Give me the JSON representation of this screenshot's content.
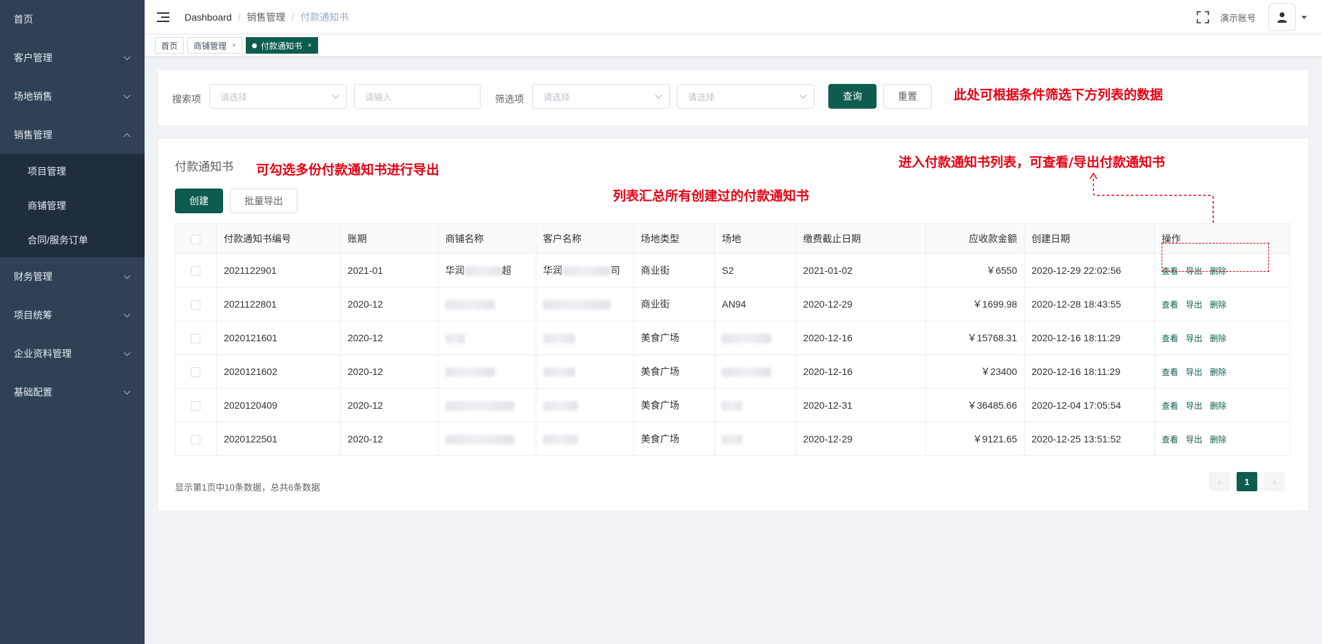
{
  "sidebar": {
    "items": [
      {
        "label": "首页"
      },
      {
        "label": "客户管理"
      },
      {
        "label": "场地销售"
      },
      {
        "label": "销售管理"
      },
      {
        "label": "财务管理"
      },
      {
        "label": "项目统筹"
      },
      {
        "label": "企业资料管理"
      },
      {
        "label": "基础配置"
      }
    ],
    "sales_submenu": [
      {
        "label": "项目管理"
      },
      {
        "label": "商铺管理"
      },
      {
        "label": "合同/服务订单"
      }
    ]
  },
  "header": {
    "breadcrumb": [
      "Dashboard",
      "销售管理",
      "付款通知书"
    ],
    "account": "演示账号"
  },
  "tags": [
    {
      "label": "首页"
    },
    {
      "label": "商铺管理",
      "close": "×"
    },
    {
      "label": "付款通知书",
      "close": "×"
    }
  ],
  "filter": {
    "search_label": "搜索项",
    "search_select_placeholder": "请选择",
    "search_input_placeholder": "请输入",
    "filter_label": "筛选项",
    "filter_select1_placeholder": "请选择",
    "filter_select2_placeholder": "请选择",
    "query_button": "查询",
    "reset_button": "重置"
  },
  "annotations": {
    "filter_note": "此处可根据条件筛选下方列表的数据",
    "export_note": "可勾选多份付款通知书进行导出",
    "list_note": "列表汇总所有创建过的付款通知书",
    "action_note": "进入付款通知书列表，可查看/导出付款通知书"
  },
  "list": {
    "title": "付款通知书",
    "create_button": "创建",
    "batch_export_button": "批量导出",
    "columns": [
      "付款通知书编号",
      "账期",
      "商铺名称",
      "客户名称",
      "场地类型",
      "场地",
      "缴费截止日期",
      "应收款金额",
      "创建日期",
      "操作"
    ],
    "rows": [
      {
        "id": "2021122901",
        "period": "2021-01",
        "shop": "华润",
        "shop_tail": "超",
        "customer": "华润",
        "customer_tail": "司",
        "type": "商业街",
        "site": "S2",
        "due": "2021-01-02",
        "amount": "￥6550",
        "created": "2020-12-29 22:02:56"
      },
      {
        "id": "2021122801",
        "period": "2020-12",
        "shop": "",
        "shop_tail": "",
        "customer": "",
        "customer_tail": "",
        "type": "商业街",
        "site": "AN94",
        "due": "2020-12-29",
        "amount": "￥1699.98",
        "created": "2020-12-28 18:43:55"
      },
      {
        "id": "2020121601",
        "period": "2020-12",
        "shop": "",
        "shop_tail": "",
        "customer": "",
        "customer_tail": "",
        "type": "美食广场",
        "site": "",
        "due": "2020-12-16",
        "amount": "￥15768.31",
        "created": "2020-12-16 18:11:29"
      },
      {
        "id": "2020121602",
        "period": "2020-12",
        "shop": "",
        "shop_tail": "",
        "customer": "",
        "customer_tail": "",
        "type": "美食广场",
        "site": "",
        "due": "2020-12-16",
        "amount": "￥23400",
        "created": "2020-12-16 18:11:29"
      },
      {
        "id": "2020120409",
        "period": "2020-12",
        "shop": "",
        "shop_tail": "",
        "customer": "",
        "customer_tail": "",
        "type": "美食广场",
        "site": "",
        "due": "2020-12-31",
        "amount": "￥36485.66",
        "created": "2020-12-04 17:05:54"
      },
      {
        "id": "2020122501",
        "period": "2020-12",
        "shop": "",
        "shop_tail": "",
        "customer": "",
        "customer_tail": "",
        "type": "美食广场",
        "site": "",
        "due": "2020-12-29",
        "amount": "￥9121.65",
        "created": "2020-12-25 13:51:52"
      }
    ],
    "actions": [
      "查看",
      "导出",
      "删除"
    ]
  },
  "pagination": {
    "summary": "显示第1页中10条数据，总共6条数据",
    "prev": "‹",
    "current": "1",
    "next": "›"
  },
  "colors": {
    "sidebar_bg": "#304156",
    "accent": "#0d5c4d",
    "annotation": "#e60012"
  }
}
